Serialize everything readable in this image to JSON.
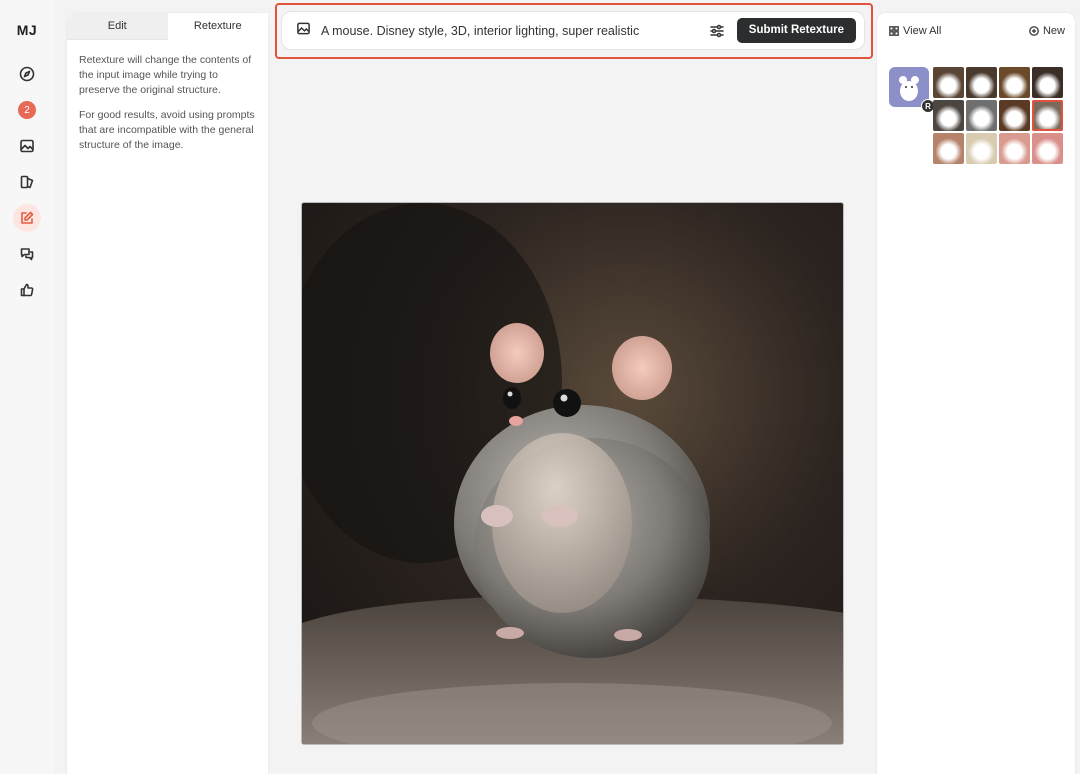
{
  "app": {
    "logo": "MJ",
    "notification_count": "2"
  },
  "rail": [
    {
      "icon": "compass-icon"
    },
    {
      "icon": "notification-badge"
    },
    {
      "icon": "image-icon"
    },
    {
      "icon": "library-icon"
    },
    {
      "icon": "edit-icon",
      "active": true
    },
    {
      "icon": "chat-icon"
    },
    {
      "icon": "thumbs-up-icon"
    }
  ],
  "left_panel": {
    "tabs": [
      {
        "label": "Edit",
        "active": false
      },
      {
        "label": "Retexture",
        "active": true
      }
    ],
    "paragraph1": "Retexture will change the contents of the input image while trying to preserve the original structure.",
    "paragraph2": "For good results, avoid using prompts that are incompatible with the general structure of the image."
  },
  "prompt": {
    "text": "A mouse. Disney style, 3D, interior lighting, super realistic",
    "submit_label": "Submit Retexture"
  },
  "right_panel": {
    "view_all_label": "View All",
    "new_label": "New",
    "source_badge": "R",
    "grid_colors": [
      "#5b4636",
      "#4a3a2e",
      "#6b4a2a",
      "#3a2e26",
      "#4d4640",
      "#6f6f70",
      "#5a3a25",
      "#7a6a5e",
      "#b5826a",
      "#d8cbb0",
      "#d99a8f",
      "#d98f8a"
    ],
    "selected_index": 7
  },
  "colors": {
    "accent": "#e0533f",
    "button_dark": "#2b2d2f"
  }
}
